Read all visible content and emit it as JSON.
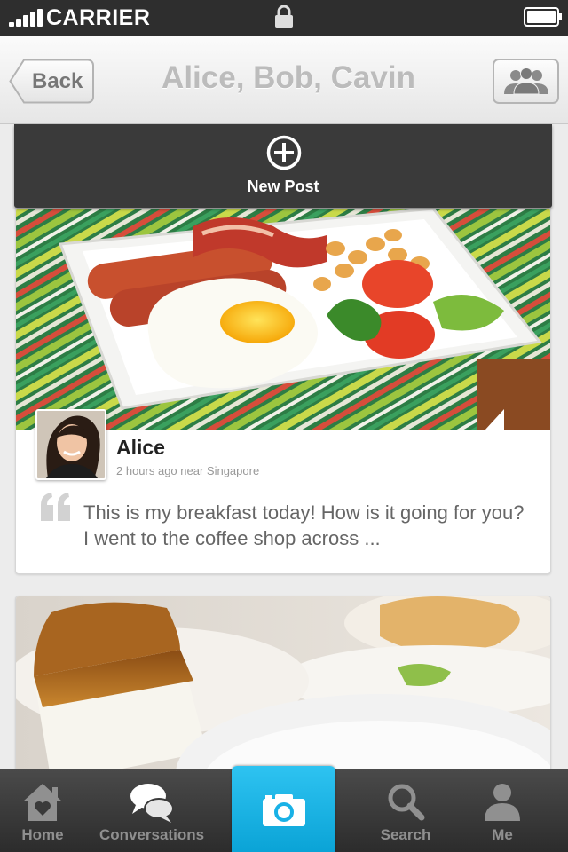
{
  "status_bar": {
    "carrier": "CARRIER"
  },
  "nav": {
    "back_label": "Back",
    "title": "Alice, Bob, Cavin"
  },
  "new_post": {
    "label": "New Post"
  },
  "posts": [
    {
      "author": "Alice",
      "meta": "2 hours ago near Singapore",
      "text": "This is my breakfast today! How is it going for you? I went to the coffee shop across ..."
    }
  ],
  "tabs": [
    {
      "label": "Home",
      "icon": "home-heart-icon"
    },
    {
      "label": "Conversations",
      "icon": "chat-bubbles-icon"
    },
    {
      "label": "",
      "icon": "camera-icon"
    },
    {
      "label": "Search",
      "icon": "search-icon"
    },
    {
      "label": "Me",
      "icon": "person-icon"
    }
  ],
  "colors": {
    "accent": "#18b1e6",
    "tab_bar": "#3a3a3a",
    "title_gray": "#bcbcbc"
  }
}
